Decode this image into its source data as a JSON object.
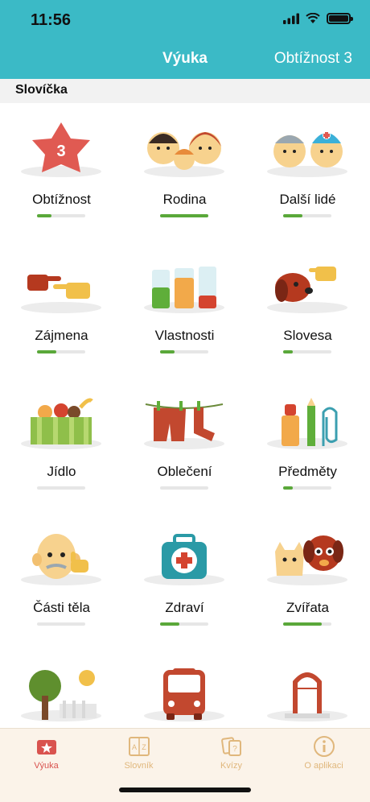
{
  "status": {
    "time": "11:56"
  },
  "nav": {
    "title": "Výuka",
    "right_label": "Obtížnost 3"
  },
  "section": {
    "label": "Slovíčka"
  },
  "difficulty_badge": "3",
  "categories": [
    {
      "label": "Obtížnost",
      "icon": "star-badge-icon",
      "progress": 0.3
    },
    {
      "label": "Rodina",
      "icon": "family-icon",
      "progress": 1.0
    },
    {
      "label": "Další lidé",
      "icon": "people-nurses-icon",
      "progress": 0.4
    },
    {
      "label": "Zájmena",
      "icon": "pointing-hands-icon",
      "progress": 0.4
    },
    {
      "label": "Vlastnosti",
      "icon": "glasses-of-juice-icon",
      "progress": 0.3
    },
    {
      "label": "Slovesa",
      "icon": "dog-hand-icon",
      "progress": 0.2
    },
    {
      "label": "Jídlo",
      "icon": "fruit-crate-icon",
      "progress": 0.0
    },
    {
      "label": "Oblečení",
      "icon": "clothesline-icon",
      "progress": 0.0
    },
    {
      "label": "Předměty",
      "icon": "bottle-pencil-clip-icon",
      "progress": 0.2
    },
    {
      "label": "Části těla",
      "icon": "old-man-face-icon",
      "progress": 0.0
    },
    {
      "label": "Zdraví",
      "icon": "first-aid-kit-icon",
      "progress": 0.4
    },
    {
      "label": "Zvířata",
      "icon": "cat-dog-icon",
      "progress": 0.8
    },
    {
      "label": "",
      "icon": "tree-sun-icon",
      "progress": 0.0
    },
    {
      "label": "",
      "icon": "bus-icon",
      "progress": 0.0
    },
    {
      "label": "",
      "icon": "door-icon",
      "progress": 0.0
    }
  ],
  "tabs": [
    {
      "label": "Výuka",
      "icon": "star-card-icon",
      "active": true
    },
    {
      "label": "Slovník",
      "icon": "dictionary-az-icon",
      "active": false
    },
    {
      "label": "Kvízy",
      "icon": "quiz-cards-icon",
      "active": false
    },
    {
      "label": "O aplikaci",
      "icon": "info-icon",
      "active": false
    }
  ],
  "colors": {
    "header": "#3bbac6",
    "progress": "#5aa83a",
    "tab_active": "#d9534f",
    "tab_inactive": "#e0b77c"
  }
}
